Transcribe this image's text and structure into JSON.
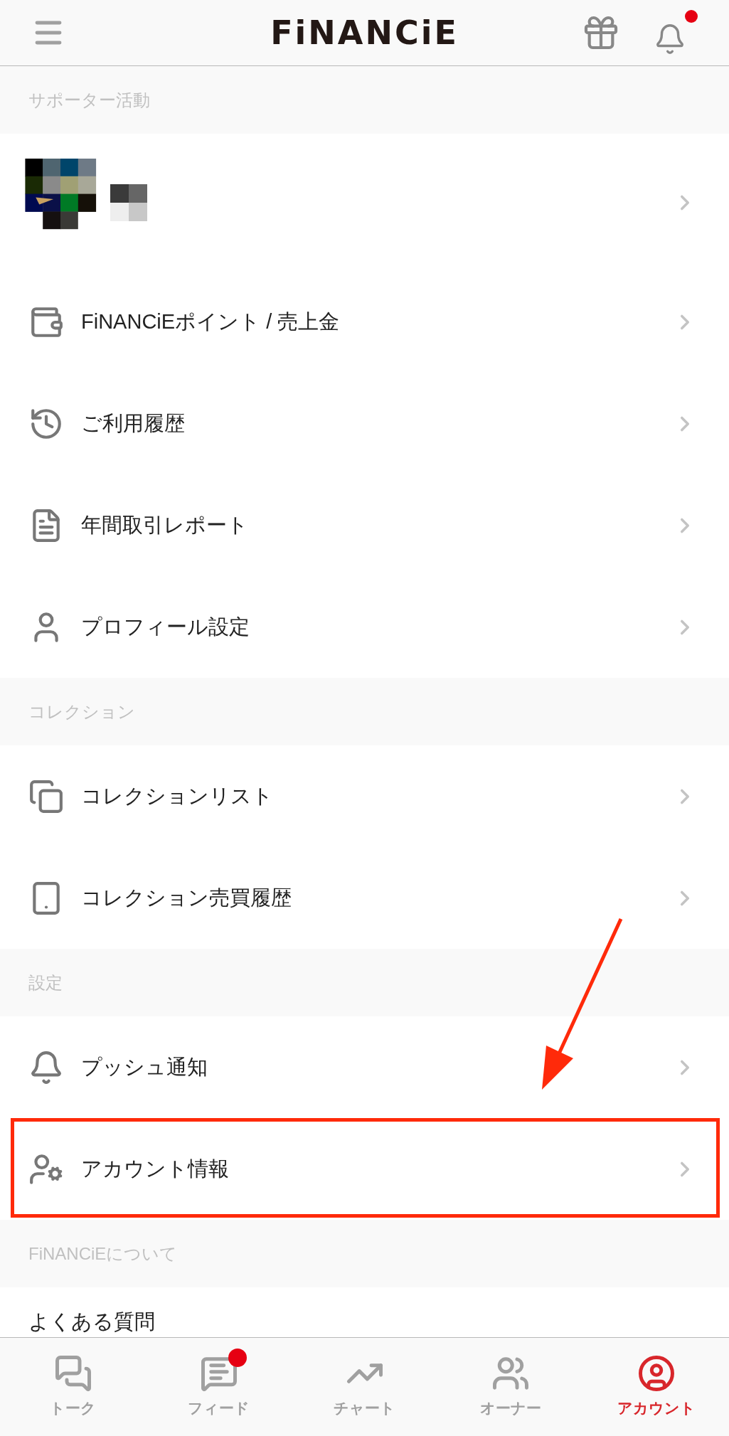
{
  "header": {
    "logo": "FiNANCiE",
    "bell_unread": true
  },
  "sections": [
    {
      "title": "サポーター活動",
      "rows": [
        {
          "kind": "profile"
        },
        {
          "kind": "link",
          "label": "FiNANCiEポイント / 売上金"
        },
        {
          "kind": "link",
          "label": "ご利用履歴"
        },
        {
          "kind": "link",
          "label": "年間取引レポート"
        },
        {
          "kind": "link",
          "label": "プロフィール設定"
        }
      ]
    },
    {
      "title": "コレクション",
      "rows": [
        {
          "kind": "link",
          "label": "コレクションリスト"
        },
        {
          "kind": "link",
          "label": "コレクション売買履歴"
        }
      ]
    },
    {
      "title": "設定",
      "rows": [
        {
          "kind": "link",
          "label": "プッシュ通知"
        },
        {
          "kind": "link",
          "label": "アカウント情報",
          "highlighted": true
        }
      ]
    },
    {
      "title": "FiNANCiEについて",
      "rows": [
        {
          "kind": "partial",
          "label": "よくある質問"
        }
      ]
    }
  ],
  "tabs": [
    {
      "label": "トーク",
      "selected": false,
      "unread": false
    },
    {
      "label": "フィード",
      "selected": false,
      "unread": true
    },
    {
      "label": "チャート",
      "selected": false,
      "unread": false
    },
    {
      "label": "オーナー",
      "selected": false,
      "unread": false
    },
    {
      "label": "アカウント",
      "selected": true,
      "unread": false
    }
  ]
}
